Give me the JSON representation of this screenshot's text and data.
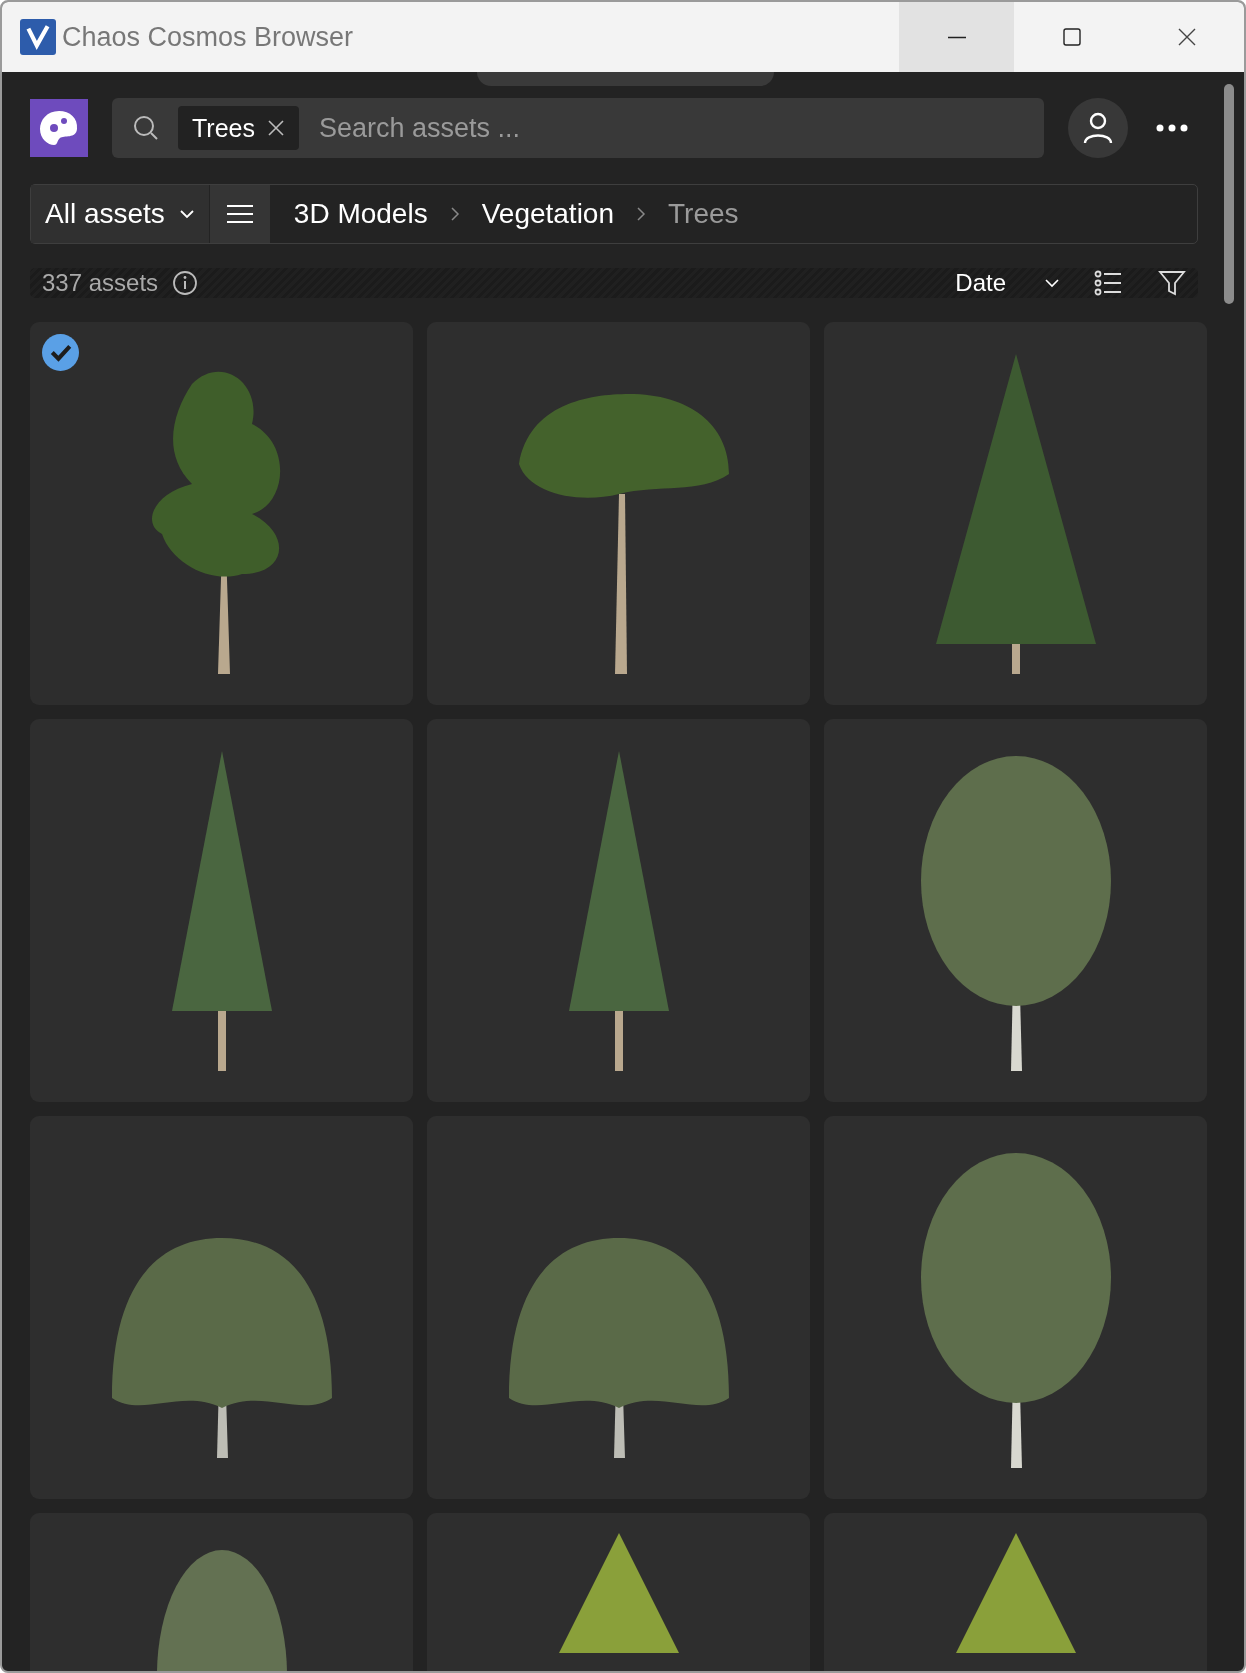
{
  "window": {
    "title": "Chaos Cosmos Browser",
    "controls": [
      {
        "kind": "minimize",
        "hovered": true
      },
      {
        "kind": "maximize",
        "hovered": false
      },
      {
        "kind": "close",
        "hovered": false
      }
    ]
  },
  "search": {
    "tag": "Trees",
    "placeholder": "Search assets ..."
  },
  "library_dropdown": {
    "label": "All assets"
  },
  "breadcrumb": [
    {
      "label": "3D Models",
      "current": false
    },
    {
      "label": "Vegetation",
      "current": false
    },
    {
      "label": "Trees",
      "current": true
    }
  ],
  "toolbar": {
    "count": "337 assets",
    "sort": "Date"
  },
  "assets": [
    {
      "kind": "pine",
      "selected": true
    },
    {
      "kind": "umbrella",
      "selected": false
    },
    {
      "kind": "spruce",
      "selected": false
    },
    {
      "kind": "fir",
      "selected": false
    },
    {
      "kind": "fir",
      "selected": false
    },
    {
      "kind": "birch",
      "selected": false
    },
    {
      "kind": "weeping",
      "selected": false
    },
    {
      "kind": "weeping",
      "selected": false
    },
    {
      "kind": "birch",
      "selected": false
    },
    {
      "kind": "broadleaf",
      "selected": false
    },
    {
      "kind": "young",
      "selected": false
    },
    {
      "kind": "young",
      "selected": false
    }
  ]
}
